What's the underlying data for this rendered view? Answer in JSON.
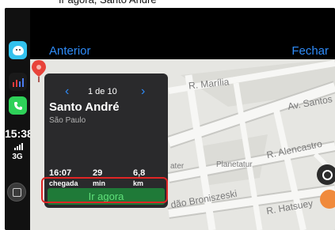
{
  "caption": "Ir agora, Santo André",
  "top_nav": {
    "back_label": "Anterior",
    "close_label": "Fechar"
  },
  "status": {
    "time": "15:38",
    "network": "3G"
  },
  "dock": {
    "apps": [
      "waze-icon",
      "dashboard-icon",
      "phone-icon"
    ]
  },
  "map": {
    "streets": [
      "R. Marília",
      "Av. Santos",
      "R. Alencastro",
      "Planetatur",
      "dão Broniszeski",
      "R. Hatsuey",
      "ater"
    ],
    "pin_color": "#e8433a"
  },
  "card": {
    "counter": "1 de 10",
    "title": "Santo André",
    "subtitle": "São Paulo",
    "stats": [
      {
        "value": "16:07",
        "unit": "chegada"
      },
      {
        "value": "29",
        "unit": "min"
      },
      {
        "value": "6,8",
        "unit": "km"
      }
    ],
    "go_label": "Ir agora"
  },
  "colors": {
    "accent": "#2f8cfa",
    "go_bg": "#1f7a38",
    "go_text": "#5fe07a",
    "highlight": "#e02525"
  }
}
